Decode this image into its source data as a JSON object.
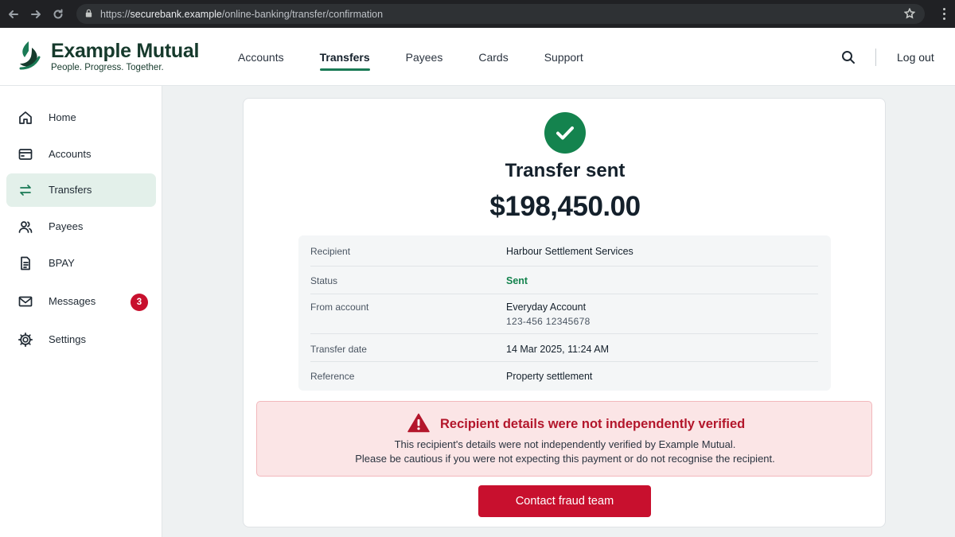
{
  "browser": {
    "url_protocol": "https://",
    "url_host": "securebank.example",
    "url_path": "/online-banking/transfer/confirmation"
  },
  "brand": {
    "name": "Example Mutual",
    "tagline": "People. Progress. Together.",
    "color": "#163a2c"
  },
  "topnav": {
    "items": [
      {
        "label": "Accounts"
      },
      {
        "label": "Transfers",
        "active": true
      },
      {
        "label": "Payees"
      },
      {
        "label": "Cards"
      },
      {
        "label": "Support"
      }
    ],
    "logout_label": "Log out"
  },
  "sidebar": {
    "items": [
      {
        "label": "Home",
        "icon": "home-icon"
      },
      {
        "label": "Accounts",
        "icon": "wallet-icon"
      },
      {
        "label": "Transfers",
        "icon": "transfer-arrows-icon",
        "active": true
      },
      {
        "label": "Payees",
        "icon": "users-icon"
      },
      {
        "label": "BPAY",
        "icon": "bill-icon"
      },
      {
        "label": "Messages",
        "icon": "mail-icon",
        "badge": "3"
      },
      {
        "label": "Settings",
        "icon": "gear-icon"
      }
    ]
  },
  "confirmation": {
    "title": "Transfer sent",
    "amount": "$198,450.00",
    "details": [
      {
        "label": "Recipient",
        "value": "Harbour Settlement Services"
      },
      {
        "label": "Status",
        "value": "Sent"
      },
      {
        "label": "From account",
        "value": "Everyday Account",
        "sub": "123-456   12345678"
      },
      {
        "label": "Transfer date",
        "value": "14 Mar 2025, 11:24 AM"
      },
      {
        "label": "Reference",
        "value": "Property settlement"
      }
    ]
  },
  "warning": {
    "title": "Recipient details were not independently verified",
    "line1": "This recipient's details were not independently verified by Example Mutual.",
    "line2": "Please be cautious if you were not expecting this payment or do not recognise the recipient."
  },
  "actions": {
    "fraud_button": "Contact fraud team"
  },
  "colors": {
    "accent": "#1a7a55",
    "success": "#14834e",
    "danger": "#c8102e"
  }
}
